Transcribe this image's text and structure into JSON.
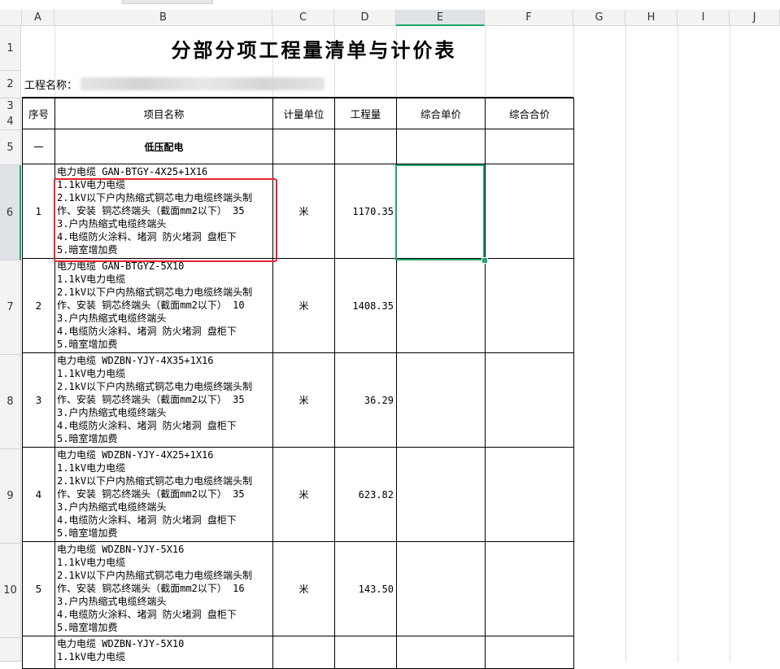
{
  "columns": [
    "A",
    "B",
    "C",
    "D",
    "E",
    "F",
    "G",
    "H",
    "I",
    "J"
  ],
  "rows": {
    "r1": "1",
    "r2": "2",
    "r3": "3",
    "r4": "4",
    "r5": "5",
    "r6": "6",
    "r7": "7",
    "r8": "8",
    "r9": "9",
    "r10": "10"
  },
  "sheet": {
    "title": "分部分项工程量清单与计价表",
    "project_label": "工程名称：",
    "headers": {
      "seq": "序号",
      "item_name": "项目名称",
      "unit": "计量单位",
      "quantity": "工程量",
      "unit_price": "综合单价",
      "total_price": "综合合价"
    },
    "section": {
      "seq": "一",
      "name": "低压配电"
    },
    "items": [
      {
        "seq": "1",
        "lines": [
          "电力电缆 GAN-BTGY-4X25+1X16",
          "1.1kV电力电缆",
          "2.1kV以下户内热缩式铜芯电力电缆终端头制",
          "作、安装 铜芯终端头（截面mm2以下） 35",
          "3.户内热缩式电缆终端头",
          "4.电缆防火涂料、堵洞 防火堵洞 盘柜下",
          "5.暗室增加费"
        ],
        "unit": "米",
        "quantity": "1170.35"
      },
      {
        "seq": "2",
        "lines": [
          "电力电缆 GAN-BTGYZ-5X10",
          "1.1kV电力电缆",
          "2.1kV以下户内热缩式铜芯电力电缆终端头制",
          "作、安装 铜芯终端头（截面mm2以下） 10",
          "3.户内热缩式电缆终端头",
          "4.电缆防火涂料、堵洞 防火堵洞 盘柜下",
          "5.暗室增加费"
        ],
        "unit": "米",
        "quantity": "1408.35"
      },
      {
        "seq": "3",
        "lines": [
          "电力电缆 WDZBN-YJY-4X35+1X16",
          "1.1kV电力电缆",
          "2.1kV以下户内热缩式铜芯电力电缆终端头制",
          "作、安装 铜芯终端头（截面mm2以下） 35",
          "3.户内热缩式电缆终端头",
          "4.电缆防火涂料、堵洞 防火堵洞 盘柜下",
          "5.暗室增加费"
        ],
        "unit": "米",
        "quantity": "36.29"
      },
      {
        "seq": "4",
        "lines": [
          "电力电缆 WDZBN-YJY-4X25+1X16",
          "1.1kV电力电缆",
          "2.1kV以下户内热缩式铜芯电力电缆终端头制",
          "作、安装 铜芯终端头（截面mm2以下） 35",
          "3.户内热缩式电缆终端头",
          "4.电缆防火涂料、堵洞 防火堵洞 盘柜下",
          "5.暗室增加费"
        ],
        "unit": "米",
        "quantity": "623.82"
      },
      {
        "seq": "5",
        "lines": [
          "电力电缆 WDZBN-YJY-5X16",
          "1.1kV电力电缆",
          "2.1kV以下户内热缩式铜芯电力电缆终端头制",
          "作、安装 铜芯终端头（截面mm2以下） 16",
          "3.户内热缩式电缆终端头",
          "4.电缆防火涂料、堵洞 防火堵洞 盘柜下",
          "5.暗室增加费"
        ],
        "unit": "米",
        "quantity": "143.50"
      },
      {
        "seq": "",
        "lines": [
          "电力电缆 WDZBN-YJY-5X10",
          "1.1kV电力电缆"
        ],
        "unit": "",
        "quantity": ""
      }
    ]
  },
  "colors": {
    "selection": "#1fa66a",
    "annotation": "#e8262e"
  }
}
